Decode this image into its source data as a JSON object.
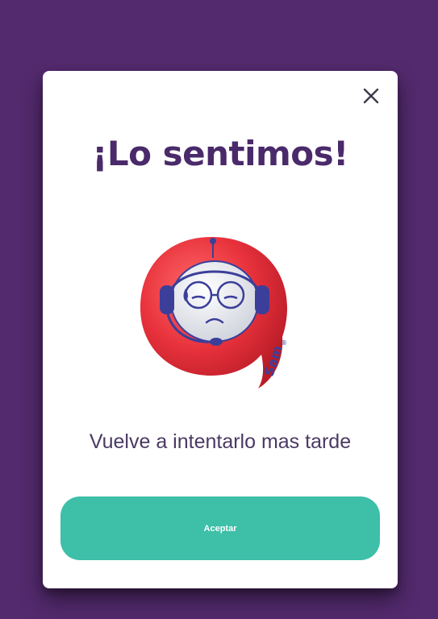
{
  "dialog": {
    "title": "¡Lo sentimos!",
    "message": "Vuelve a intentarlo mas tarde",
    "accept_label": "Aceptar",
    "mascot_name": "Sam",
    "close_icon": "close-icon"
  },
  "colors": {
    "backdrop": "#532a6e",
    "title": "#4a2a6a",
    "button": "#3dbfa8",
    "mascot_red": "#e8323c"
  }
}
